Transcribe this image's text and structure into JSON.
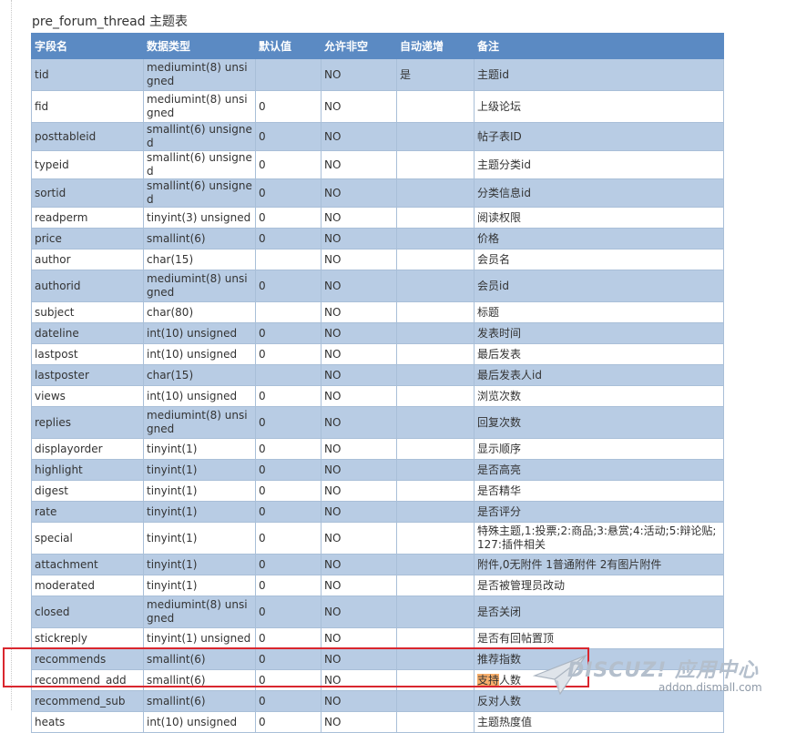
{
  "caption": "pre_forum_thread 主题表",
  "columns": [
    "字段名",
    "数据类型",
    "默认值",
    "允许非空",
    "自动递增",
    "备注"
  ],
  "rows": [
    {
      "field": "tid",
      "type": "mediumint(8) unsigned",
      "default": "",
      "nullable": "NO",
      "auto": "是",
      "note": "主题id"
    },
    {
      "field": "fid",
      "type": "mediumint(8) unsigned",
      "default": "0",
      "nullable": "NO",
      "auto": "",
      "note": "上级论坛"
    },
    {
      "field": "posttableid",
      "type": "smallint(6) unsigned",
      "default": "0",
      "nullable": "NO",
      "auto": "",
      "note": "帖子表ID"
    },
    {
      "field": "typeid",
      "type": "smallint(6) unsigned",
      "default": "0",
      "nullable": "NO",
      "auto": "",
      "note": "主题分类id"
    },
    {
      "field": "sortid",
      "type": "smallint(6) unsigned",
      "default": "0",
      "nullable": "NO",
      "auto": "",
      "note": "分类信息id"
    },
    {
      "field": "readperm",
      "type": "tinyint(3) unsigned",
      "default": "0",
      "nullable": "NO",
      "auto": "",
      "note": "阅读权限"
    },
    {
      "field": "price",
      "type": "smallint(6)",
      "default": "0",
      "nullable": "NO",
      "auto": "",
      "note": "价格"
    },
    {
      "field": "author",
      "type": "char(15)",
      "default": "",
      "nullable": "NO",
      "auto": "",
      "note": "会员名"
    },
    {
      "field": "authorid",
      "type": "mediumint(8) unsigned",
      "default": "0",
      "nullable": "NO",
      "auto": "",
      "note": "会员id"
    },
    {
      "field": "subject",
      "type": "char(80)",
      "default": "",
      "nullable": "NO",
      "auto": "",
      "note": "标题"
    },
    {
      "field": "dateline",
      "type": "int(10) unsigned",
      "default": "0",
      "nullable": "NO",
      "auto": "",
      "note": "发表时间"
    },
    {
      "field": "lastpost",
      "type": "int(10) unsigned",
      "default": "0",
      "nullable": "NO",
      "auto": "",
      "note": "最后发表"
    },
    {
      "field": "lastposter",
      "type": "char(15)",
      "default": "",
      "nullable": "NO",
      "auto": "",
      "note": "最后发表人id"
    },
    {
      "field": "views",
      "type": "int(10) unsigned",
      "default": "0",
      "nullable": "NO",
      "auto": "",
      "note": "浏览次数"
    },
    {
      "field": "replies",
      "type": "mediumint(8) unsigned",
      "default": "0",
      "nullable": "NO",
      "auto": "",
      "note": "回复次数"
    },
    {
      "field": "displayorder",
      "type": "tinyint(1)",
      "default": "0",
      "nullable": "NO",
      "auto": "",
      "note": "显示顺序"
    },
    {
      "field": "highlight",
      "type": "tinyint(1)",
      "default": "0",
      "nullable": "NO",
      "auto": "",
      "note": "是否高亮"
    },
    {
      "field": "digest",
      "type": "tinyint(1)",
      "default": "0",
      "nullable": "NO",
      "auto": "",
      "note": "是否精华"
    },
    {
      "field": "rate",
      "type": "tinyint(1)",
      "default": "0",
      "nullable": "NO",
      "auto": "",
      "note": "是否评分"
    },
    {
      "field": "special",
      "type": "tinyint(1)",
      "default": "0",
      "nullable": "NO",
      "auto": "",
      "note": "特殊主题,1:投票;2:商品;3:悬赏;4:活动;5:辩论贴;127:插件相关"
    },
    {
      "field": "attachment",
      "type": "tinyint(1)",
      "default": "0",
      "nullable": "NO",
      "auto": "",
      "note": "附件,0无附件 1普通附件 2有图片附件"
    },
    {
      "field": "moderated",
      "type": "tinyint(1)",
      "default": "0",
      "nullable": "NO",
      "auto": "",
      "note": "是否被管理员改动"
    },
    {
      "field": "closed",
      "type": "mediumint(8) unsigned",
      "default": "0",
      "nullable": "NO",
      "auto": "",
      "note": "是否关闭"
    },
    {
      "field": "stickreply",
      "type": "tinyint(1) unsigned",
      "default": "0",
      "nullable": "NO",
      "auto": "",
      "note": "是否有回帖置顶"
    },
    {
      "field": "recommends",
      "type": "smallint(6)",
      "default": "0",
      "nullable": "NO",
      "auto": "",
      "note": "推荐指数"
    },
    {
      "field": "recommend_add",
      "type": "smallint(6)",
      "default": "0",
      "nullable": "NO",
      "auto": "",
      "note_hl": "支持",
      "note": "人数"
    },
    {
      "field": "recommend_sub",
      "type": "smallint(6)",
      "default": "0",
      "nullable": "NO",
      "auto": "",
      "note": "反对人数"
    },
    {
      "field": "heats",
      "type": "int(10) unsigned",
      "default": "0",
      "nullable": "NO",
      "auto": "",
      "note": "主题热度值"
    }
  ],
  "watermark": {
    "title": "DISCUZ! 应用中心",
    "url": "addon.dismall.com"
  },
  "colors": {
    "header": "#5b8ac3",
    "row_alt": "#b8cce4",
    "highlight_box": "#d9262e"
  }
}
